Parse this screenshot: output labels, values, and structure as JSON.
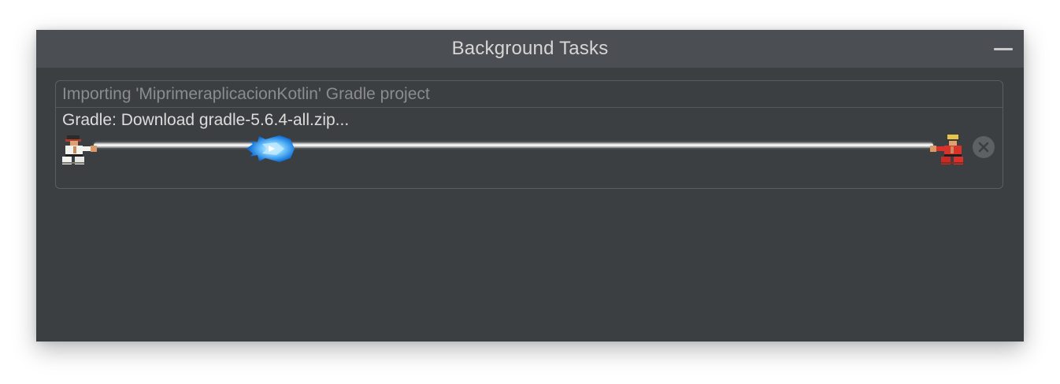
{
  "window": {
    "title": "Background Tasks",
    "minimize_icon": "minimize-icon"
  },
  "task": {
    "title": "Importing 'MiprimeraplicacionKotlin' Gradle project",
    "subtitle": "Gradle: Download gradle-5.6.4-all.zip...",
    "progress": 0.21,
    "cancel_icon": "close-circle-icon",
    "left_icon": "fighter-icon",
    "right_icon": "fighter-icon",
    "indicator_icon": "fireball-icon"
  },
  "colors": {
    "window_bg": "#3c3f41",
    "titlebar_bg": "#4b4e52",
    "fireball": "#2a9df4"
  }
}
